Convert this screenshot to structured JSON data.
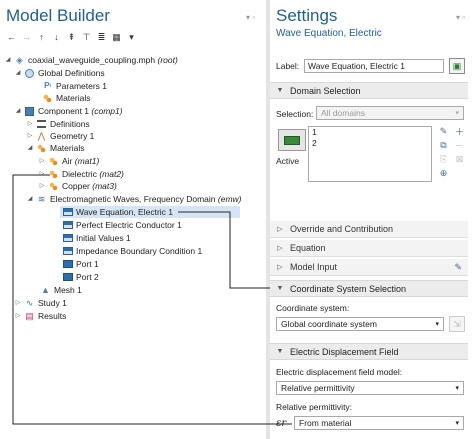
{
  "model_builder": {
    "title": "Model Builder",
    "toolbar": [
      "back-icon",
      "forward-icon",
      "up-icon",
      "down-icon",
      "collapse-icon",
      "expand-icon",
      "list-icon",
      "table-icon",
      "more-icon"
    ],
    "tree": {
      "root": {
        "file": "coaxial_waveguide_coupling.mph",
        "tag": "(root)"
      },
      "global_definitions": "Global Definitions",
      "parameters": "Parameters 1",
      "global_materials": "Materials",
      "component": {
        "name": "Component 1",
        "tag": "(comp1)"
      },
      "definitions": "Definitions",
      "geometry": "Geometry 1",
      "materials": "Materials",
      "air": {
        "name": "Air",
        "tag": "(mat1)"
      },
      "dielectric": {
        "name": "Dielectric",
        "tag": "(mat2)"
      },
      "copper": {
        "name": "Copper",
        "tag": "(mat3)"
      },
      "emw": {
        "name": "Electromagnetic Waves, Frequency Domain",
        "tag": "(emw)"
      },
      "wave_eq": "Wave Equation, Electric 1",
      "pec": "Perfect Electric Conductor 1",
      "init": "Initial Values 1",
      "ibc": "Impedance Boundary Condition 1",
      "port1": "Port 1",
      "port2": "Port 2",
      "mesh": "Mesh 1",
      "study": "Study 1",
      "results": "Results"
    }
  },
  "settings": {
    "title": "Settings",
    "subtitle": "Wave Equation, Electric",
    "label_caption": "Label:",
    "label_value": "Wave Equation, Electric 1",
    "domain_selection": {
      "header": "Domain Selection",
      "selection_caption": "Selection:",
      "selection_value": "All domains",
      "domains": [
        "1",
        "2"
      ],
      "active_label": "Active"
    },
    "collapsed_sections": [
      "Override and Contribution",
      "Equation",
      "Model Input"
    ],
    "coordinate_system": {
      "header": "Coordinate System Selection",
      "caption": "Coordinate system:",
      "value": "Global coordinate system"
    },
    "electric_displacement": {
      "header": "Electric Displacement Field",
      "model_caption": "Electric displacement field model:",
      "model_value": "Relative permittivity",
      "perm_caption": "Relative permittivity:",
      "symbol": "εr",
      "perm_value": "From material"
    }
  },
  "colors": {
    "title_blue": "#1f5f92",
    "selection_highlight": "#d6e5f5"
  }
}
